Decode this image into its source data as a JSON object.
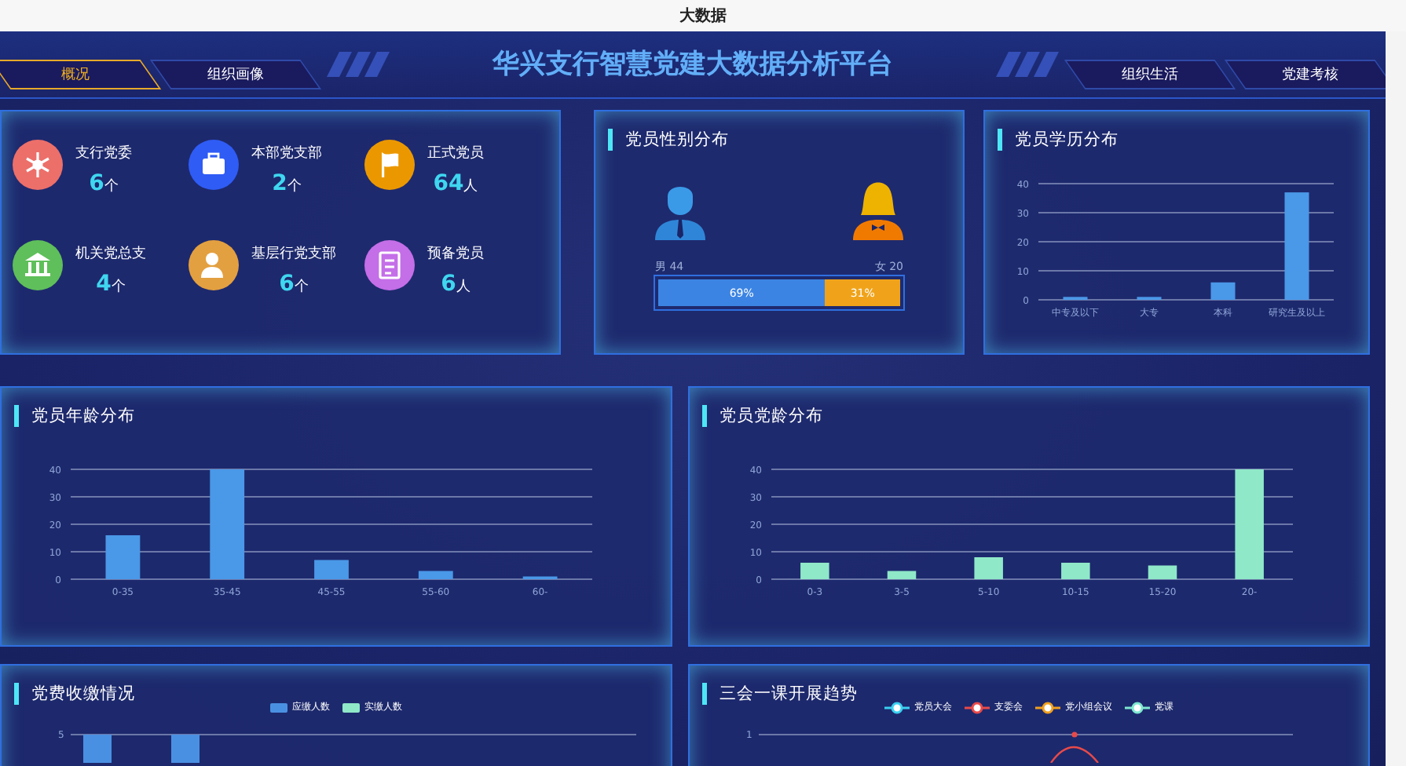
{
  "window": {
    "title": "大数据"
  },
  "header": {
    "title": "华兴支行智慧党建大数据分析平台",
    "left_tabs": [
      {
        "label": "概况",
        "selected": true
      },
      {
        "label": "组织画像",
        "selected": false
      }
    ],
    "right_tabs": [
      {
        "label": "组织生活",
        "selected": false
      },
      {
        "label": "党建考核",
        "selected": false
      }
    ]
  },
  "stats": [
    {
      "label": "支行党委",
      "value": "6",
      "unit": "个",
      "kind": "snowflake",
      "color": "#ec6f6a"
    },
    {
      "label": "本部党支部",
      "value": "2",
      "unit": "个",
      "kind": "briefcase",
      "color": "#2f5cf5"
    },
    {
      "label": "正式党员",
      "value": "64",
      "unit": "人",
      "kind": "flag",
      "color": "#eb9800"
    },
    {
      "label": "机关党总支",
      "value": "4",
      "unit": "个",
      "kind": "bank",
      "color": "#5fbf5a"
    },
    {
      "label": "基层行党支部",
      "value": "6",
      "unit": "个",
      "kind": "person",
      "color": "#e3a040"
    },
    {
      "label": "预备党员",
      "value": "6",
      "unit": "人",
      "kind": "document",
      "color": "#c46ee8"
    }
  ],
  "gender": {
    "title": "党员性别分布",
    "male_label": "男 44",
    "female_label": "女 20",
    "male": {
      "level": 0.69,
      "percent": "69%"
    },
    "female": {
      "percent": "31%"
    }
  },
  "education": {
    "title": "党员学历分布",
    "chart_data": {
      "type": "bar",
      "categories": [
        "中专及以下",
        "大专",
        "本科",
        "研究生及以上"
      ],
      "values": [
        1,
        1,
        6,
        37
      ],
      "grid": true,
      "ylim": [
        0,
        40
      ],
      "yticks": [
        0,
        10,
        20,
        30,
        40
      ]
    }
  },
  "age": {
    "title": "党员年龄分布",
    "chart_data": {
      "type": "bar",
      "categories": [
        "0-35",
        "35-45",
        "45-55",
        "55-60",
        "60-"
      ],
      "values": [
        16,
        40,
        7,
        3,
        1
      ],
      "grid": true,
      "ylim": [
        0,
        40
      ],
      "yticks": [
        0,
        10,
        20,
        30,
        40
      ]
    }
  },
  "party_age": {
    "title": "党员党龄分布",
    "chart_data": {
      "type": "bar",
      "categories": [
        "0-3",
        "3-5",
        "5-10",
        "10-15",
        "15-20",
        "20-"
      ],
      "values": [
        6,
        3,
        8,
        6,
        5,
        40
      ],
      "grid": true,
      "ylim": [
        0,
        40
      ],
      "yticks": [
        0,
        10,
        20,
        30,
        40
      ]
    }
  },
  "fees": {
    "title": "党费收缴情况",
    "legend": [
      {
        "label": "应缴人数",
        "color": "#4a90e2"
      },
      {
        "label": "实缴人数",
        "color": "#8fe8c8"
      }
    ],
    "top_tick": "5"
  },
  "meetings": {
    "title": "三会一课开展趋势",
    "legend": [
      {
        "label": "党员大会",
        "color": "#3ad0f0"
      },
      {
        "label": "支委会",
        "color": "#e84a4a"
      },
      {
        "label": "党小组会议",
        "color": "#f0a020"
      },
      {
        "label": "党课",
        "color": "#7ee8d0"
      }
    ],
    "top_tick": "1"
  }
}
